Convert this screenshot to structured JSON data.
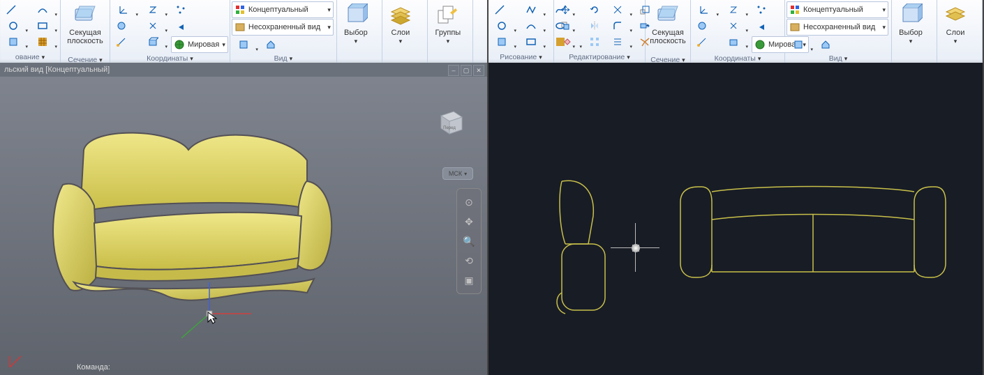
{
  "left": {
    "panels": {
      "draw": "ование",
      "section": "Сечение",
      "coords": "Координаты",
      "view": "Вид"
    },
    "bigbtns": {
      "section1": "Секущая",
      "section2": "плоскость",
      "select": "Выбор",
      "layers": "Слои",
      "groups": "Группы"
    },
    "combos": {
      "world": "Мировая",
      "visualstyle": "Концептуальный",
      "savedview": "Несохраненный вид"
    },
    "viewport": {
      "title": "льский вид [Концептуальный]",
      "cube_front": "Перед",
      "msk": "МСК",
      "command": "Команда:"
    }
  },
  "right": {
    "panels": {
      "draw": "Рисование",
      "edit": "Редактирование",
      "section": "Сечение",
      "coords": "Координаты",
      "view": "Вид"
    },
    "bigbtns": {
      "section1": "Секущая",
      "section2": "плоскость",
      "select": "Выбор",
      "layers": "Слои"
    },
    "combos": {
      "world": "Мировая",
      "visualstyle": "Концептуальный",
      "savedview": "Несохраненный вид"
    }
  }
}
